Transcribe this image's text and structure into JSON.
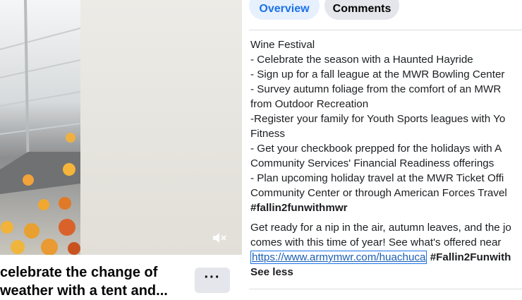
{
  "tabs": {
    "overview": "Overview",
    "comments": "Comments"
  },
  "description": {
    "lines": [
      "Wine Festival",
      "- Celebrate the season with a Haunted Hayride",
      "- Sign up for a fall league at the MWR Bowling Center",
      "- Survey autumn foliage from the comfort of an MWR",
      "from Outdoor Recreation",
      "-Register your family for Youth Sports leagues with Yo",
      "Fitness",
      "- Get your checkbook prepped for the holidays with A",
      "Community Services' Financial Readiness offerings",
      "- Plan upcoming holiday travel at the MWR Ticket Offi",
      "Community Center or through American Forces Travel"
    ],
    "hashtag": "#fallin2funwithmwr",
    "para2_line1": "Get ready for a nip in the air, autumn leaves, and the jo",
    "para2_line2": "comes with this time of year! See what's offered near",
    "link": "https://www.armymwr.com/huachuca",
    "hashtag2": "#Fallin2Funwith",
    "see_less": "See less"
  },
  "video": {
    "title": "celebrate the change of weather with a tent and...",
    "more": "···",
    "mute_icon": "speaker-muted-icon"
  }
}
